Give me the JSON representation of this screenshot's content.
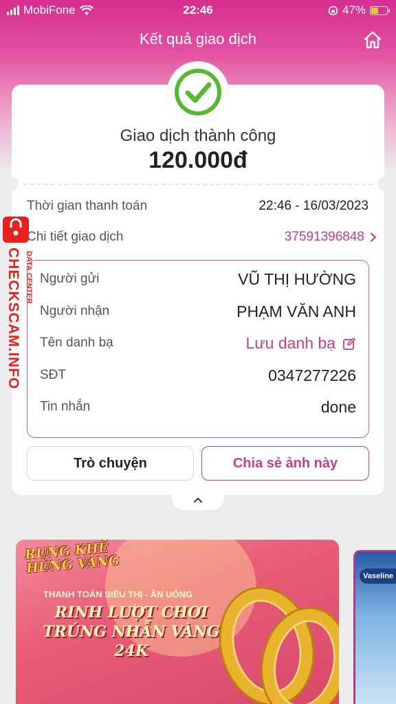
{
  "status_bar": {
    "carrier": "MobiFone",
    "time": "22:46",
    "battery": "47%",
    "battery_level": 0.47
  },
  "nav": {
    "title": "Kết quả giao dịch"
  },
  "result": {
    "status": "Giao dịch thành công",
    "amount": "120.000đ",
    "time_label": "Thời gian thanh toán",
    "time_value": "22:46 - 16/03/2023",
    "detail_label": "Chi tiết giao dịch",
    "detail_value": "37591396848"
  },
  "details": {
    "sender_label": "Người gửi",
    "sender_value": "VŨ THỊ HƯỜNG",
    "receiver_label": "Người nhận",
    "receiver_value": "PHẠM VĂN ANH",
    "contact_label": "Tên danh bạ",
    "contact_value": "Lưu danh bạ",
    "phone_label": "SĐT",
    "phone_value": "0347277226",
    "message_label": "Tin nhắn",
    "message_value": "done"
  },
  "actions": {
    "chat": "Trò chuyện",
    "share": "Chia sẻ ảnh này"
  },
  "banner": {
    "logo": "RUNG KHẾ HỨNG VÀNG",
    "sub": "THANH TOÁN SIÊU THỊ - ĂN UỐNG",
    "promo_line1": "RINH LƯỢT CHƠI",
    "promo_line2": "TRÚNG NHẪN VÀNG 24K"
  },
  "banner2": {
    "brand": "Vaseline"
  },
  "watermark": {
    "text": "CHECKSCAM.INFO",
    "sub": "DATA CENTER"
  },
  "colors": {
    "accent": "#c43e8b",
    "success": "#56b833"
  }
}
